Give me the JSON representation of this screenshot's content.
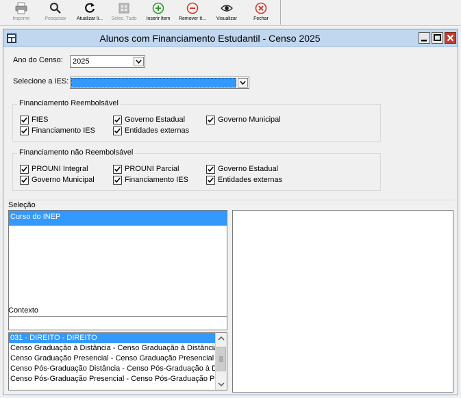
{
  "toolbar": {
    "buttons": [
      {
        "label": "Imprimir",
        "icon": "printer-icon",
        "enabled": false
      },
      {
        "label": "Pesquisar",
        "icon": "search-icon",
        "enabled": false
      },
      {
        "label": "Atualizar li...",
        "icon": "refresh-icon",
        "enabled": true
      },
      {
        "label": "Selec. Tudo",
        "icon": "select-all-icon",
        "enabled": false
      },
      {
        "label": "Inserir Item",
        "icon": "add-icon",
        "enabled": true
      },
      {
        "label": "Remover It...",
        "icon": "remove-icon",
        "enabled": true
      },
      {
        "label": "Visualizar",
        "icon": "eye-icon",
        "enabled": true
      },
      {
        "label": "Fechar",
        "icon": "close-icon",
        "enabled": true
      }
    ]
  },
  "window": {
    "title": "Alunos com Financiamento Estudantil - Censo 2025"
  },
  "form": {
    "ano_label": "Ano do Censo:",
    "ano_value": "2025",
    "ies_label": "Selecione a IES:",
    "ies_value": ""
  },
  "reembolsavel": {
    "legend": "Financiamento Reembolsável",
    "items": [
      {
        "label": "FIES",
        "checked": true
      },
      {
        "label": "Governo Estadual",
        "checked": true
      },
      {
        "label": "Governo Municipal",
        "checked": true
      },
      {
        "label": "Financiamento IES",
        "checked": true
      },
      {
        "label": "Entidades externas",
        "checked": true
      }
    ]
  },
  "nao_reembolsavel": {
    "legend": "Financiamento não Reembolsável",
    "items": [
      {
        "label": "PROUNI Integral",
        "checked": true
      },
      {
        "label": "PROUNI Parcial",
        "checked": true
      },
      {
        "label": "Governo Estadual",
        "checked": true
      },
      {
        "label": "Governo Municipal",
        "checked": true
      },
      {
        "label": "Financiamento IES",
        "checked": true
      },
      {
        "label": "Entidades externas",
        "checked": true
      }
    ]
  },
  "selecao": {
    "label": "Seleção",
    "items": [
      "Curso do INEP"
    ]
  },
  "contexto": {
    "label": "Contexto",
    "search_value": "",
    "items": [
      "031 - DIREITO - DIREITO",
      "Censo Graduação à Distância - Censo Graduação à Distância",
      "Censo Graduação Presencial - Censo Graduação Presencial",
      "Censo Pós-Graduação Distância - Censo Pós-Graduação à Distância",
      "Censo Pós-Graduação Presencial - Censo Pós-Graduação Presencial"
    ]
  },
  "colors": {
    "titlebar": "#c1d7ef",
    "selection": "#3399ff",
    "close_button": "#c43c2c"
  }
}
